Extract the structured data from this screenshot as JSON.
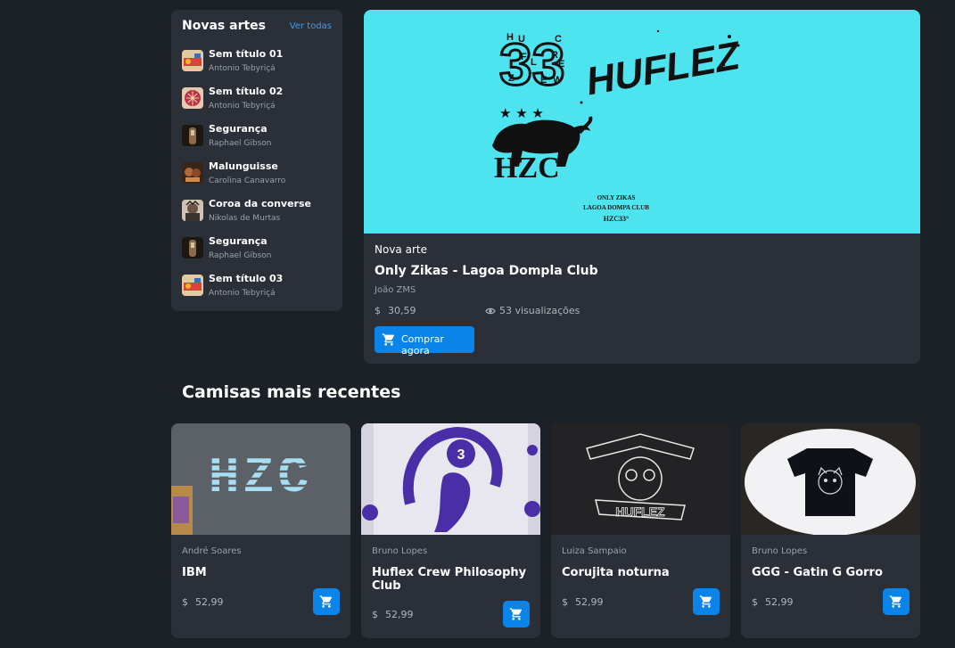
{
  "sidebar": {
    "title": "Novas artes",
    "see_all": "Ver todas",
    "items": [
      {
        "name": "Sem título 01",
        "author": "Antonio Tebyriçá",
        "thumb_color": "#d9443a"
      },
      {
        "name": "Sem título 02",
        "author": "Antonio Tebyriçá",
        "thumb_color": "#b9324a"
      },
      {
        "name": "Segurança",
        "author": "Raphael Gibson",
        "thumb_color": "#4a3626"
      },
      {
        "name": "Malunguisse",
        "author": "Carolina Canavarro",
        "thumb_color": "#7a4128"
      },
      {
        "name": "Coroa da converse",
        "author": "Nikolas de Murtas",
        "thumb_color": "#8c7b6a"
      },
      {
        "name": "Segurança",
        "author": "Raphael Gibson",
        "thumb_color": "#4a3626"
      },
      {
        "name": "Sem título 03",
        "author": "Antonio Tebyriçá",
        "thumb_color": "#d9443a"
      }
    ]
  },
  "featured": {
    "label": "Nova arte",
    "title": "Only Zikas - Lagoa Dompla Club",
    "author": "João ZMS",
    "currency": "$",
    "price": "30,59",
    "views": "53 visualizações",
    "buy_label": "Comprar agora",
    "art": {
      "logo_number": "33",
      "logo_letters": [
        "H",
        "U",
        "C",
        "F",
        "L",
        "R",
        "E",
        "Z",
        "E",
        "W"
      ],
      "wordmark": "HUFLEZ",
      "stars": "★ ★ ★",
      "badge": "HZC",
      "caption_lines": [
        "ONLY ZIKAS",
        "LAGOA DOMPA CLUB",
        "HZC33°"
      ],
      "bg_color": "#4de3ef"
    }
  },
  "section_title": "Camisas mais recentes",
  "products": [
    {
      "seller": "André Soares",
      "title": "IBM",
      "currency": "$",
      "price": "52,99",
      "print": "HZC",
      "shirt_color": "#5c6168"
    },
    {
      "seller": "Bruno Lopes",
      "title": "Huflex Crew Philosophy Club",
      "currency": "$",
      "price": "52,99",
      "print": "3",
      "shirt_color": "#e8e6ef"
    },
    {
      "seller": "Luiza Sampaio",
      "title": "Corujita noturna",
      "currency": "$",
      "price": "52,99",
      "print": "HUFLEZ",
      "shirt_color": "#232325"
    },
    {
      "seller": "Bruno Lopes",
      "title": "GGG - Gatin G Gorro",
      "currency": "$",
      "price": "52,99",
      "print": "",
      "shirt_color": "#0f1118"
    }
  ],
  "colors": {
    "background": "#1c2128",
    "panel": "#2b3038",
    "accent": "#0a84e8",
    "link": "#3d9bf0",
    "muted_text": "#9aa0a8"
  },
  "icons": {
    "cart": "shopping-cart-icon",
    "views": "eye-icon"
  }
}
